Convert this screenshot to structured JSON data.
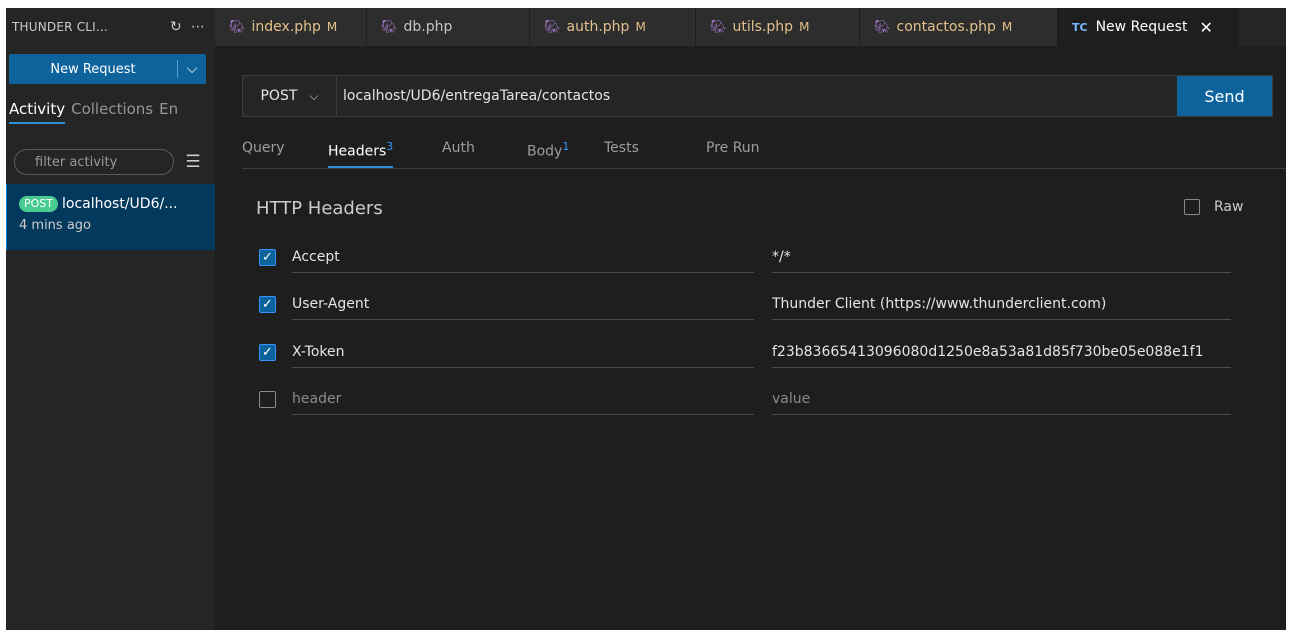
{
  "sidebar": {
    "title": "THUNDER CLI...",
    "refresh_icon": "refresh-icon",
    "more_icon": "ellipsis-icon",
    "new_request_label": "New Request",
    "tabs": [
      "Activity",
      "Collections",
      "En"
    ],
    "active_tab": "Activity",
    "filter_placeholder": "filter activity",
    "activity": [
      {
        "method": "POST",
        "url": "localhost/UD6/...",
        "time": "4 mins ago"
      }
    ]
  },
  "editor_tabs": [
    {
      "label": "index.php",
      "modified": "M",
      "icon": "php-elephant-icon"
    },
    {
      "label": "db.php",
      "modified": "",
      "icon": "php-elephant-icon"
    },
    {
      "label": "auth.php",
      "modified": "M",
      "icon": "php-elephant-icon"
    },
    {
      "label": "utils.php",
      "modified": "M",
      "icon": "php-elephant-icon"
    },
    {
      "label": "contactos.php",
      "modified": "M",
      "icon": "php-elephant-icon"
    },
    {
      "label": "New Request",
      "badge": "TC",
      "active": true
    }
  ],
  "request": {
    "method": "POST",
    "url": "localhost/UD6/entregaTarea/contactos",
    "send_label": "Send",
    "tabs": [
      {
        "label": "Query",
        "count": ""
      },
      {
        "label": "Headers",
        "count": "3",
        "active": true
      },
      {
        "label": "Auth",
        "count": ""
      },
      {
        "label": "Body",
        "count": "1"
      },
      {
        "label": "Tests",
        "count": ""
      },
      {
        "label": "Pre Run",
        "count": ""
      }
    ]
  },
  "headers_section": {
    "title": "HTTP Headers",
    "raw_label": "Raw",
    "rows": [
      {
        "checked": true,
        "key": "Accept",
        "value": "*/*"
      },
      {
        "checked": true,
        "key": "User-Agent",
        "value": "Thunder Client (https://www.thunderclient.com)"
      },
      {
        "checked": true,
        "key": "X-Token",
        "value": "f23b83665413096080d1250e8a53a81d85f730be05e088e1f1"
      }
    ],
    "new_row": {
      "key_placeholder": "header",
      "value_placeholder": "value"
    }
  },
  "colors": {
    "accent": "#0e639c",
    "post_badge": "#49cc90",
    "modified": "#e2c08d"
  }
}
